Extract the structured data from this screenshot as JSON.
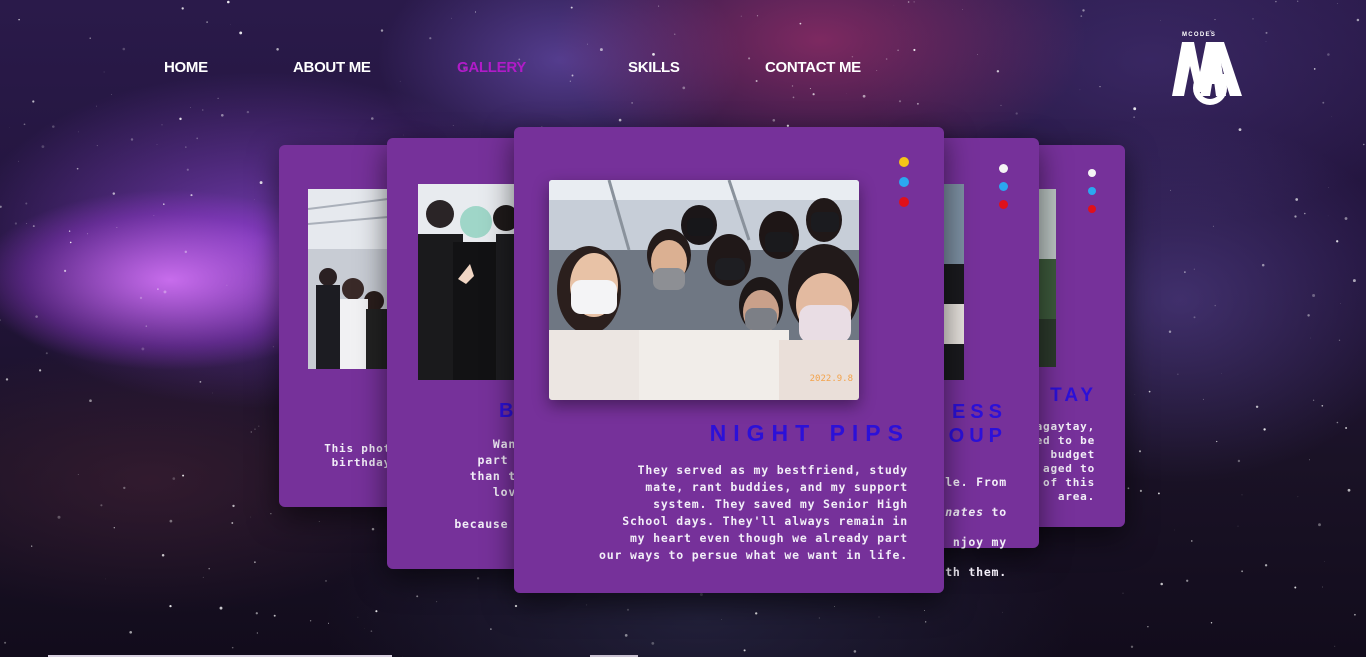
{
  "nav": {
    "items": [
      {
        "label": "HOME",
        "active": false
      },
      {
        "label": "ABOUT ME",
        "active": false
      },
      {
        "label": "GALLERY",
        "active": true
      },
      {
        "label": "SKILLS",
        "active": false
      },
      {
        "label": "CONTACT ME",
        "active": false
      }
    ]
  },
  "logo": {
    "small_text": "MCODES",
    "mark": "MA"
  },
  "cards": {
    "far_left": {
      "text": "This phot\nbirthday"
    },
    "left": {
      "title": "B",
      "text": "Wanna i\npart of m\nthan thank\nlove in\ndrea\nbecause of t"
    },
    "center": {
      "title": "NIGHT PIPS",
      "text": "They served as my bestfriend, study\nmate, rant buddies, and my support\nsystem. They saved my Senior High\nSchool days. They'll always remain in\nmy heart even though we already part\nour ways to persue what we want in life.",
      "photo_date": "2022.9.8"
    },
    "right": {
      "title_line1": "ESS",
      "title_line2": "OUP",
      "text_line1": "le. From",
      "text_line2_italic": "nates",
      "text_line2_rest": " to",
      "text_line3": "njoy my",
      "text_line4": "th them."
    },
    "far_right": {
      "title": "TAY",
      "text": "agaytay,\ned to be\n budget\naged to\n of this\narea."
    }
  },
  "colors": {
    "card_bg": "#76319a",
    "title": "#2c10d8",
    "nav_active": "#b01bc8",
    "dot_yellow": "#f5c518",
    "dot_blue": "#2aa8f0",
    "dot_red": "#e0101a",
    "dot_white": "#f4f4f4"
  }
}
